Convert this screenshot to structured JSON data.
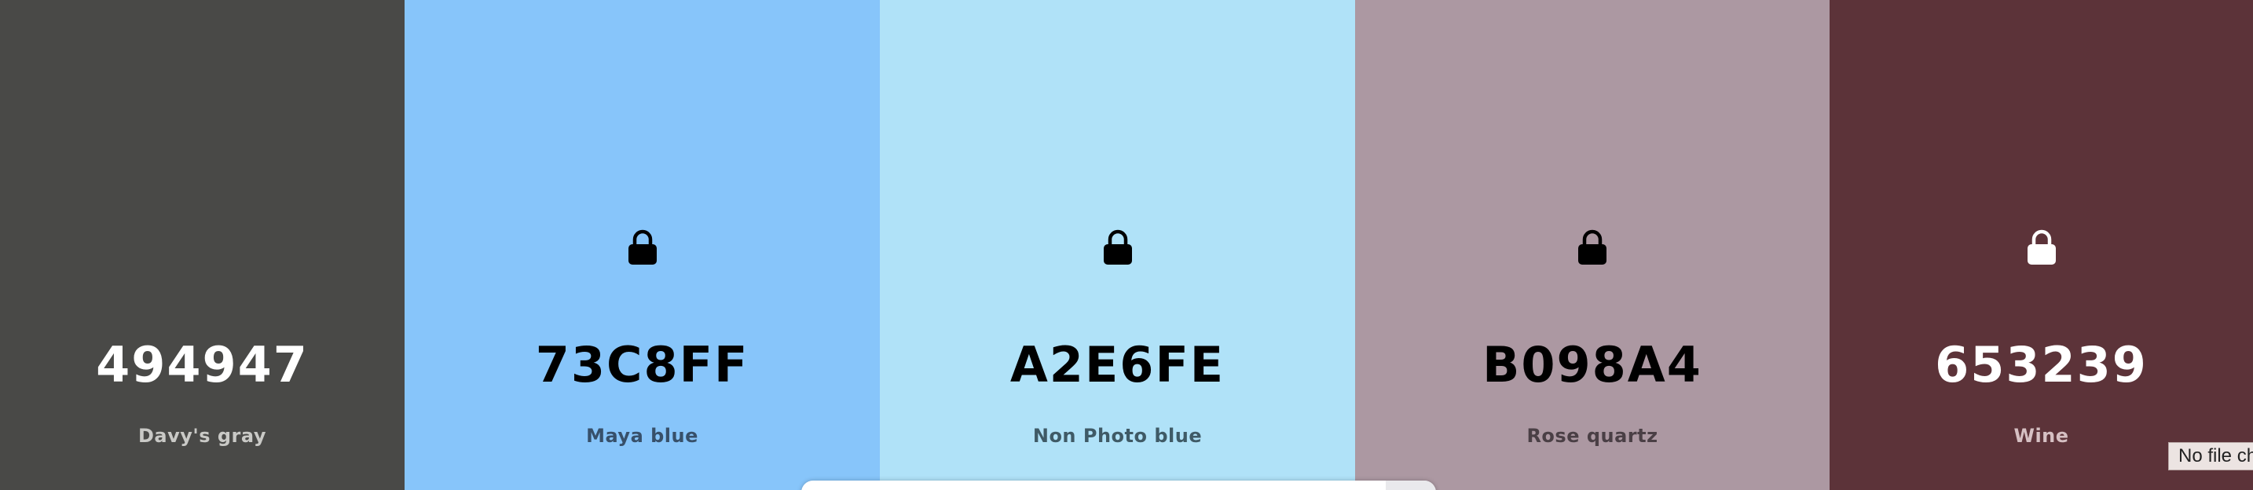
{
  "swatches": [
    {
      "hex": "494947",
      "name": "Davy's gray",
      "background": "#494947",
      "text_color": "#ffffff",
      "name_color": "#c9c9c6",
      "locked_icon_shown": false
    },
    {
      "hex": "73C8FF",
      "name": "Maya blue",
      "background": "#87C5FA",
      "text_color": "#000000",
      "name_color": "#37506a",
      "locked_icon_shown": true,
      "lock_color": "#000000"
    },
    {
      "hex": "A2E6FE",
      "name": "Non Photo blue",
      "background": "#B0E2F8",
      "text_color": "#000000",
      "name_color": "#3f5a66",
      "locked_icon_shown": true,
      "lock_color": "#000000"
    },
    {
      "hex": "B098A4",
      "name": "Rose quartz",
      "background": "#AC98A2",
      "text_color": "#000000",
      "name_color": "#4a3f45",
      "locked_icon_shown": true,
      "lock_color": "#000000"
    },
    {
      "hex": "653239",
      "name": "Wine",
      "background": "#5C3339",
      "text_color": "#ffffff",
      "name_color": "#d6c0c3",
      "locked_icon_shown": true,
      "lock_color": "#ffffff"
    }
  ],
  "lock_icon": "lock-icon",
  "file_input": {
    "text": "No file ch"
  }
}
